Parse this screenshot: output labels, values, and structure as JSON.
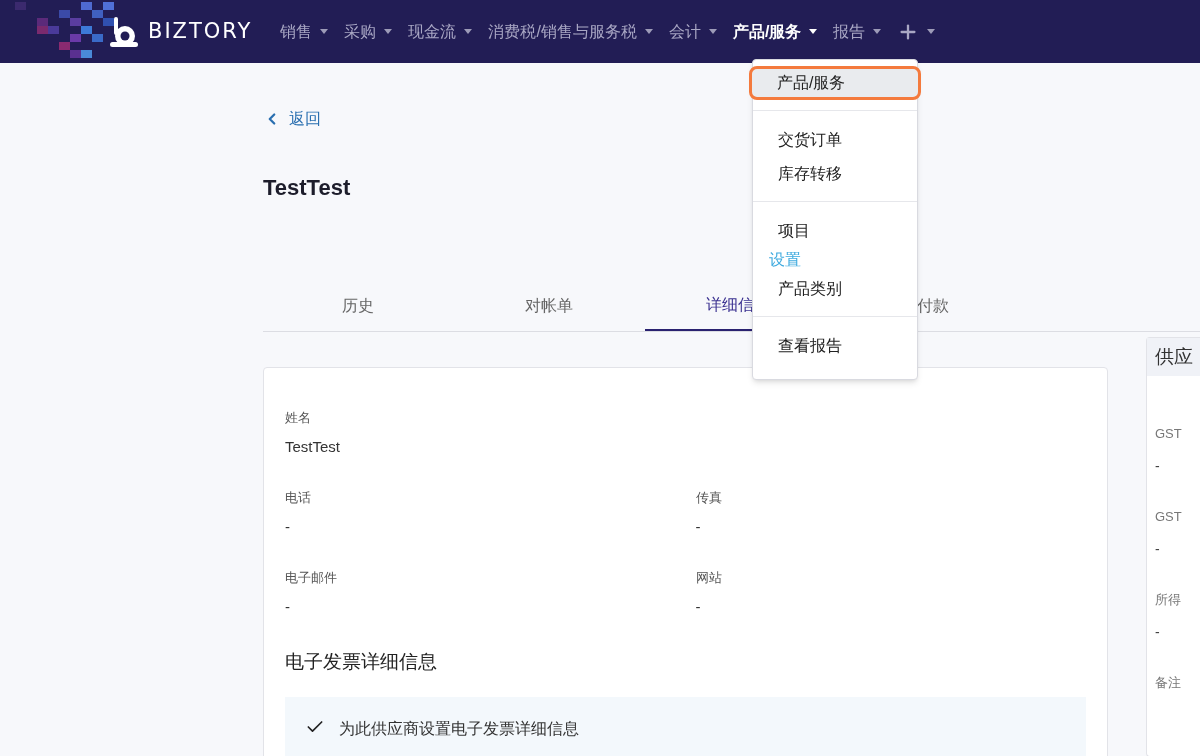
{
  "nav": {
    "brand": "BIZTORY",
    "items": [
      {
        "label": "销售",
        "selected": false,
        "kind": "text"
      },
      {
        "label": "采购",
        "selected": false,
        "kind": "text"
      },
      {
        "label": "现金流",
        "selected": false,
        "kind": "text"
      },
      {
        "label": "消费税/销售与服务税",
        "selected": false,
        "kind": "text"
      },
      {
        "label": "会计",
        "selected": false,
        "kind": "text"
      },
      {
        "label": "产品/服务",
        "selected": true,
        "kind": "text"
      },
      {
        "label": "报告",
        "selected": false,
        "kind": "text"
      },
      {
        "kind": "plus",
        "selected": false
      }
    ]
  },
  "dropdown": {
    "groups": [
      [
        {
          "kind": "item",
          "label": "产品/服务",
          "selected": true
        }
      ],
      [
        {
          "kind": "item",
          "label": "交货订单",
          "selected": false
        },
        {
          "kind": "item",
          "label": "库存转移",
          "selected": false
        }
      ],
      [
        {
          "kind": "item",
          "label": "项目",
          "selected": false
        },
        {
          "kind": "header",
          "label": "设置"
        },
        {
          "kind": "item",
          "label": "产品类别",
          "selected": false
        }
      ],
      [
        {
          "kind": "item",
          "label": "查看报告",
          "selected": false
        }
      ]
    ]
  },
  "back": "返回",
  "title": "TestTest",
  "tabs": [
    {
      "label": "历史",
      "selected": false
    },
    {
      "label": "对帐单",
      "selected": false
    },
    {
      "label": "详细信",
      "selected": true
    },
    {
      "label": "付款",
      "selected": false
    }
  ],
  "details": {
    "fields": [
      {
        "label": "姓名",
        "value": "TestTest",
        "kind": "full"
      },
      {
        "label": "电话",
        "value": "-",
        "kind": "half"
      },
      {
        "label": "传真",
        "value": "-",
        "kind": "half"
      },
      {
        "label": "电子邮件",
        "value": "-",
        "kind": "half"
      },
      {
        "label": "网站",
        "value": "-",
        "kind": "half"
      }
    ],
    "einvoice": {
      "heading": "电子发票详细信息",
      "option": "为此供应商设置电子发票详细信息",
      "checked": true
    }
  },
  "side": {
    "title": "供应",
    "fields": [
      {
        "label": "GST",
        "value": "-"
      },
      {
        "label": "GST",
        "value": "-"
      },
      {
        "label": "所得",
        "value": "-"
      },
      {
        "label": "备注"
      }
    ]
  }
}
